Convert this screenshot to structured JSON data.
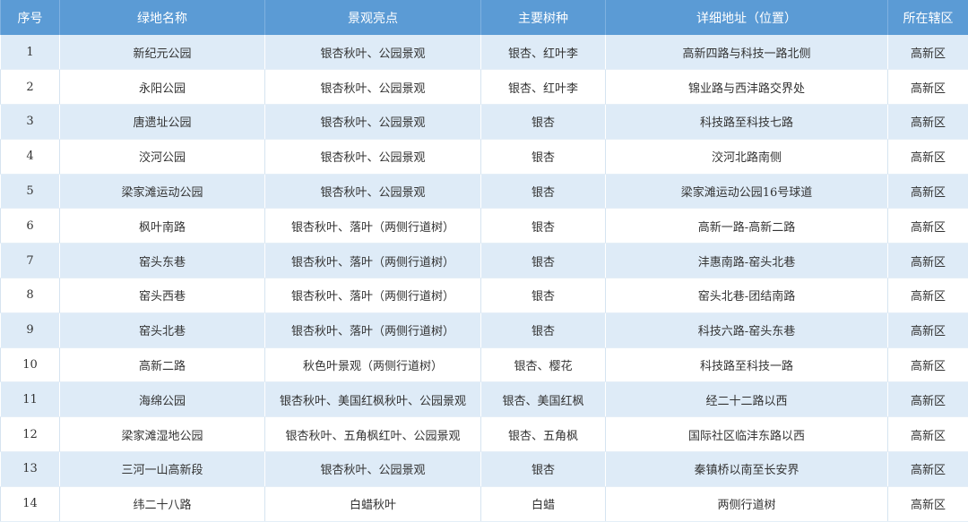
{
  "table": {
    "headers": [
      "序号",
      "绿地名称",
      "景观亮点",
      "主要树种",
      "详细地址（位置）",
      "所在辖区"
    ],
    "rows": [
      [
        "1",
        "新纪元公园",
        "银杏秋叶、公园景观",
        "银杏、红叶李",
        "高新四路与科技一路北侧",
        "高新区"
      ],
      [
        "2",
        "永阳公园",
        "银杏秋叶、公园景观",
        "银杏、红叶李",
        "锦业路与西沣路交界处",
        "高新区"
      ],
      [
        "3",
        "唐遗址公园",
        "银杏秋叶、公园景观",
        "银杏",
        "科技路至科技七路",
        "高新区"
      ],
      [
        "4",
        "洨河公园",
        "银杏秋叶、公园景观",
        "银杏",
        "洨河北路南侧",
        "高新区"
      ],
      [
        "5",
        "梁家滩运动公园",
        "银杏秋叶、公园景观",
        "银杏",
        "梁家滩运动公园16号球道",
        "高新区"
      ],
      [
        "6",
        "枫叶南路",
        "银杏秋叶、落叶（两侧行道树）",
        "银杏",
        "高新一路-高新二路",
        "高新区"
      ],
      [
        "7",
        "窑头东巷",
        "银杏秋叶、落叶（两侧行道树）",
        "银杏",
        "沣惠南路-窑头北巷",
        "高新区"
      ],
      [
        "8",
        "窑头西巷",
        "银杏秋叶、落叶（两侧行道树）",
        "银杏",
        "窑头北巷-团结南路",
        "高新区"
      ],
      [
        "9",
        "窑头北巷",
        "银杏秋叶、落叶（两侧行道树）",
        "银杏",
        "科技六路-窑头东巷",
        "高新区"
      ],
      [
        "10",
        "高新二路",
        "秋色叶景观（两侧行道树）",
        "银杏、樱花",
        "科技路至科技一路",
        "高新区"
      ],
      [
        "11",
        "海绵公园",
        "银杏秋叶、美国红枫秋叶、公园景观",
        "银杏、美国红枫",
        "经二十二路以西",
        "高新区"
      ],
      [
        "12",
        "梁家滩湿地公园",
        "银杏秋叶、五角枫红叶、公园景观",
        "银杏、五角枫",
        "国际社区临沣东路以西",
        "高新区"
      ],
      [
        "13",
        "三河一山高新段",
        "银杏秋叶、公园景观",
        "银杏",
        "秦镇桥以南至长安界",
        "高新区"
      ],
      [
        "14",
        "纬二十八路",
        "白蜡秋叶",
        "白蜡",
        "两侧行道树",
        "高新区"
      ]
    ]
  },
  "colors": {
    "header_bg": "#5b9bd5",
    "header_text": "#ffffff",
    "stripe_bg": "#deebf7",
    "plain_bg": "#ffffff",
    "body_text": "#333333"
  }
}
